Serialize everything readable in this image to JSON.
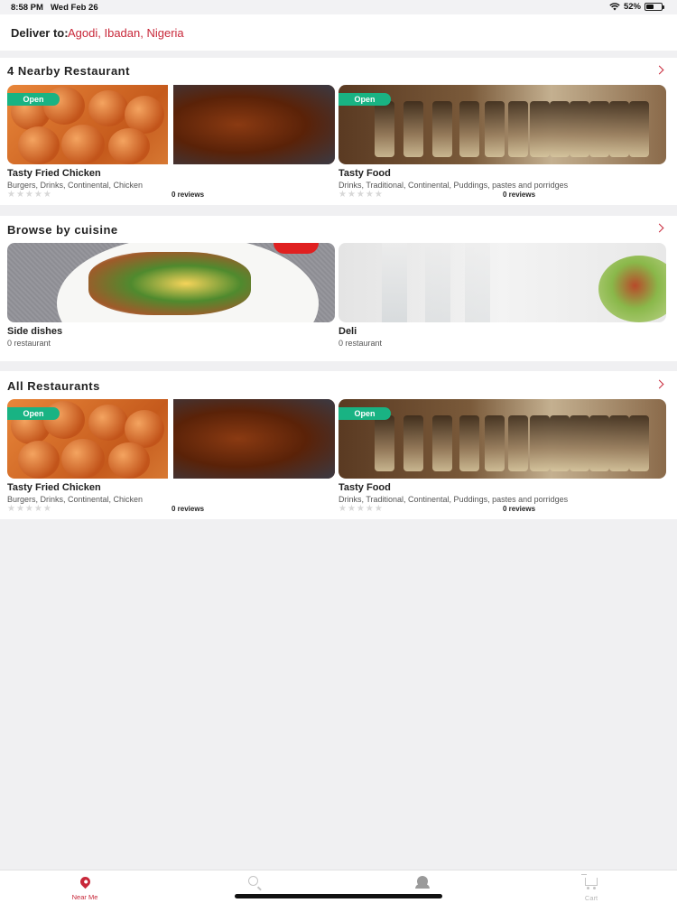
{
  "status_bar": {
    "time": "8:58 PM",
    "date": "Wed Feb 26",
    "battery": "52%",
    "battery_level": 0.52
  },
  "deliver": {
    "label": "Deliver to:",
    "location": "Agodi, Ibadan, Nigeria"
  },
  "nearby": {
    "title": "4 Nearby Restaurant",
    "cards": [
      {
        "badge": "Open",
        "name": "Tasty Fried Chicken",
        "tags": "Burgers, Drinks, Continental, Chicken",
        "stars": "★★★★★",
        "rating": 0,
        "reviews": "0 reviews"
      },
      {
        "badge": "Open",
        "name": "Tasty Food",
        "tags": "Drinks, Traditional, Continental, Puddings, pastes and porridges",
        "stars": "★★★★★",
        "rating": 0,
        "reviews": "0 reviews"
      }
    ]
  },
  "cuisine": {
    "title": "Browse by cuisine",
    "cards": [
      {
        "name": "Side dishes",
        "count": "0 restaurant"
      },
      {
        "name": "Deli",
        "count": "0 restaurant"
      }
    ]
  },
  "all": {
    "title": "All Restaurants",
    "cards": [
      {
        "badge": "Open",
        "name": "Tasty Fried Chicken",
        "tags": "Burgers, Drinks, Continental, Chicken",
        "stars": "★★★★★",
        "rating": 0,
        "reviews": "0 reviews"
      },
      {
        "badge": "Open",
        "name": "Tasty Food",
        "tags": "Drinks, Traditional, Continental, Puddings, pastes and porridges",
        "stars": "★★★★★",
        "rating": 0,
        "reviews": "0 reviews"
      }
    ]
  },
  "tabs": [
    {
      "label": "Near Me",
      "icon": "location-pin-icon",
      "active": true
    },
    {
      "label": "",
      "icon": "search-icon",
      "active": false
    },
    {
      "label": "",
      "icon": "profile-icon",
      "active": false
    },
    {
      "label": "Cart",
      "icon": "cart-icon",
      "active": false
    }
  ],
  "colors": {
    "accent": "#c8283a",
    "open_badge": "#19b383",
    "background": "#f0f0f2"
  }
}
